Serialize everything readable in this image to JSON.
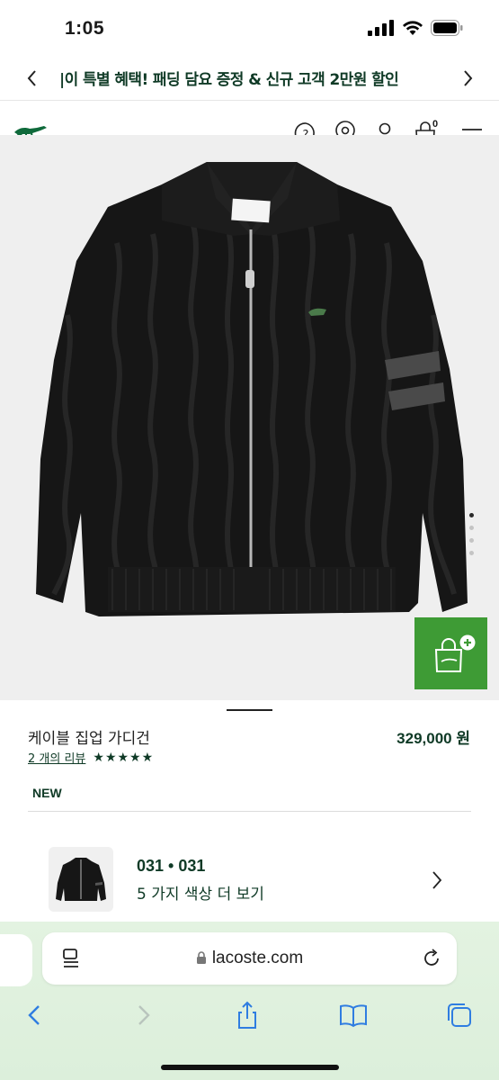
{
  "status_bar": {
    "time": "1:05"
  },
  "promo": {
    "text": "|이 특별 혜택! 패딩 담요 증정 & 신규 고객 2만원 할인"
  },
  "header": {
    "cart_count": "0"
  },
  "gallery": {
    "image_count": 4,
    "active_index": 0
  },
  "product": {
    "title": "케이블 집업 가디건",
    "price": "329,000 원",
    "reviews_link": "2 개의 리뷰",
    "stars": "★★★★★",
    "rating": 5,
    "badge": "NEW"
  },
  "color_option": {
    "code": "031 • 031",
    "more": "5 가지 색상 더 보기"
  },
  "browser": {
    "url": "lacoste.com"
  },
  "colors": {
    "brand_green": "#0f3a26",
    "fab_green": "#3e9b35"
  }
}
